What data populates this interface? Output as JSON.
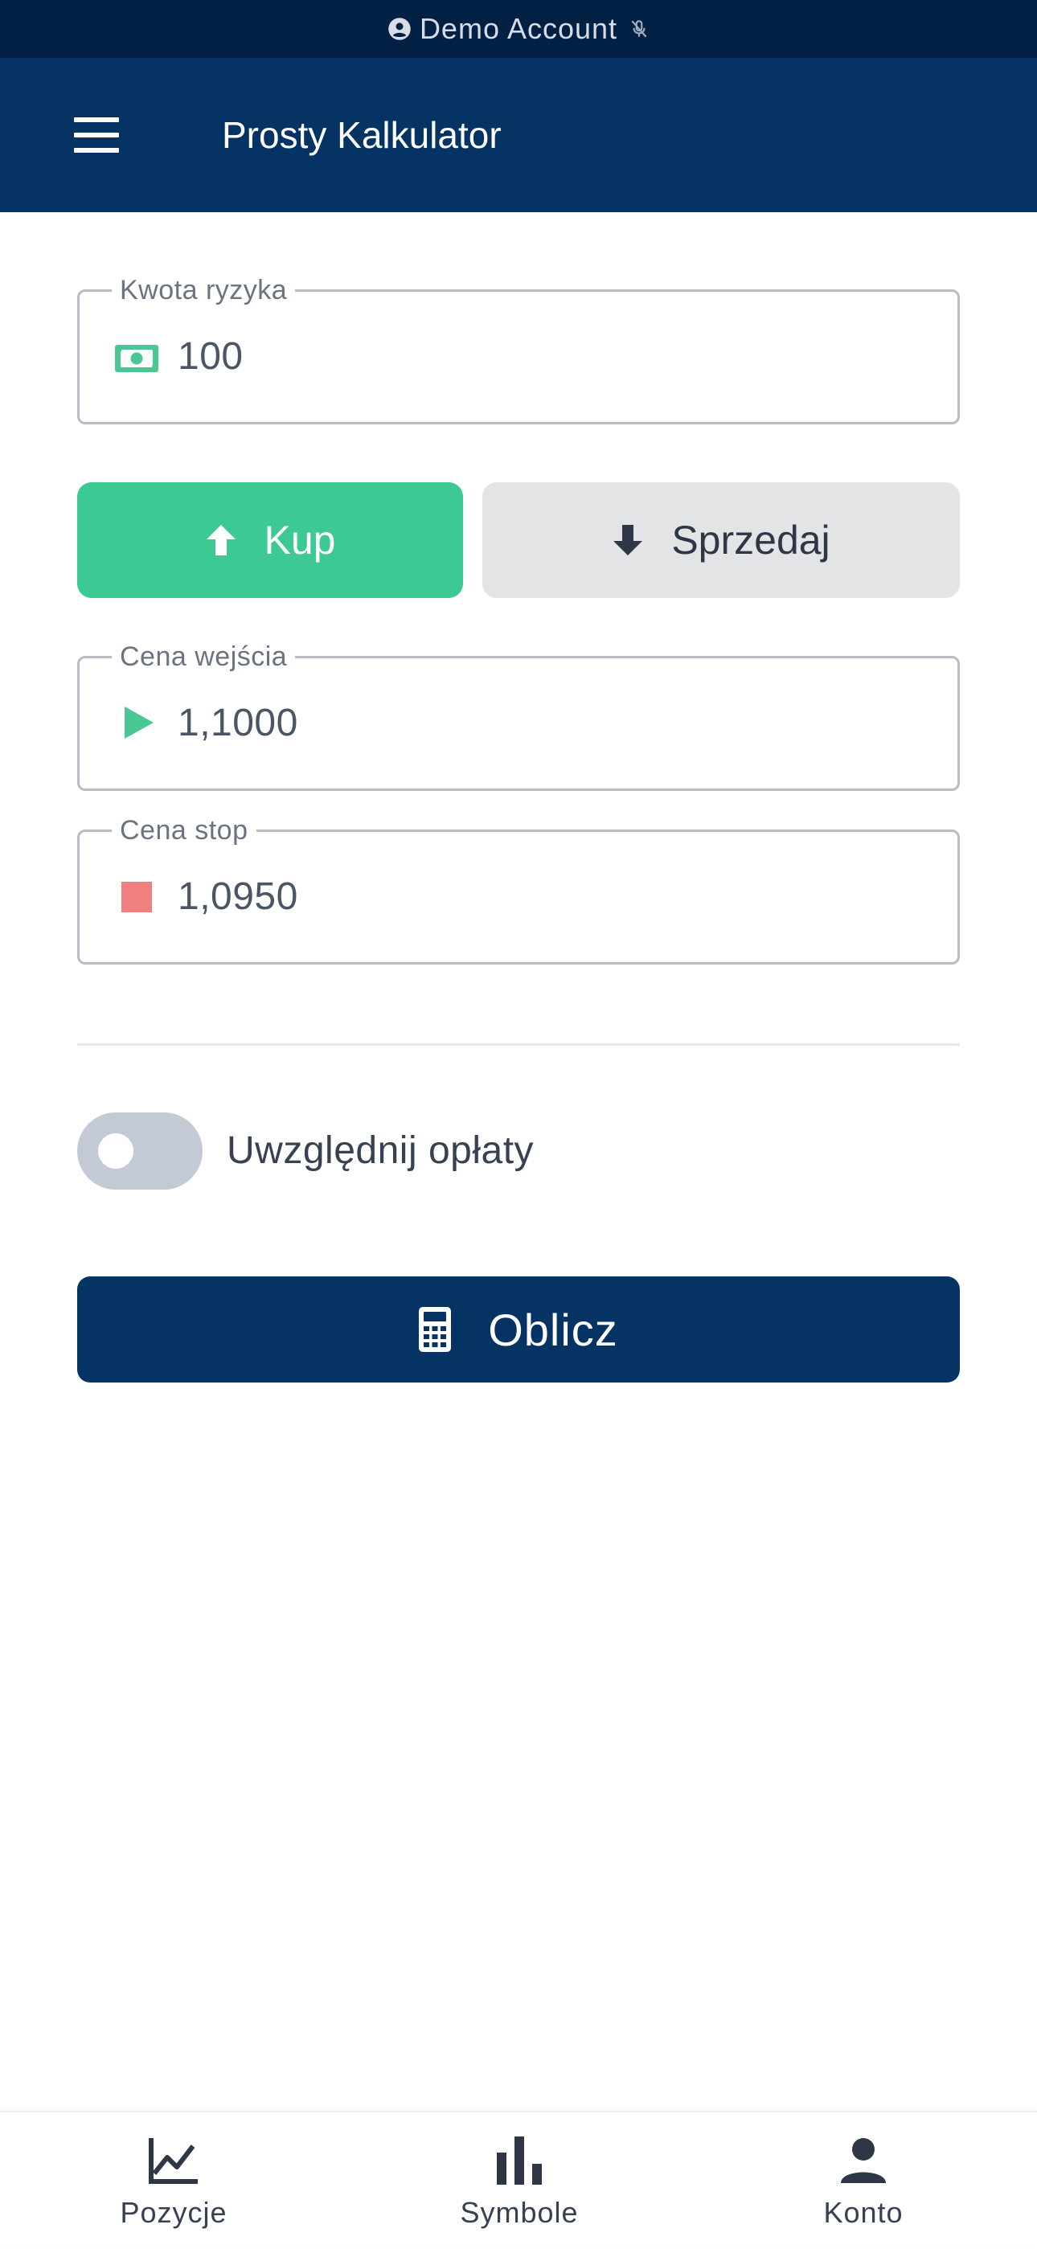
{
  "status_bar": {
    "account_label": "Demo Account",
    "account_icon": "account-circle-icon",
    "mic_icon": "mic-off-icon"
  },
  "app_bar": {
    "menu_icon": "hamburger-menu-icon",
    "title": "Prosty Kalkulator"
  },
  "form": {
    "risk_amount": {
      "label": "Kwota ryzyka",
      "value": "100",
      "icon": "cash-icon"
    },
    "direction": {
      "buy_label": "Kup",
      "sell_label": "Sprzedaj",
      "selected": "buy"
    },
    "entry_price": {
      "label": "Cena wejścia",
      "value": "1,1000",
      "icon": "play-triangle-icon"
    },
    "stop_price": {
      "label": "Cena stop",
      "value": "1,0950",
      "icon": "stop-square-icon"
    },
    "include_fees": {
      "label": "Uwzględnij opłaty",
      "enabled": false
    },
    "calculate_label": "Oblicz"
  },
  "bottom_nav": {
    "items": [
      {
        "label": "Pozycje",
        "icon": "line-chart-icon"
      },
      {
        "label": "Symbole",
        "icon": "bar-chart-icon"
      },
      {
        "label": "Konto",
        "icon": "person-icon"
      }
    ]
  },
  "colors": {
    "status_bar_bg": "#021f44",
    "primary": "#043364",
    "buy_green": "#3cc993",
    "stop_red": "#f08080",
    "segment_inactive": "#e3e4e6",
    "toggle_off": "#c3cad6"
  }
}
